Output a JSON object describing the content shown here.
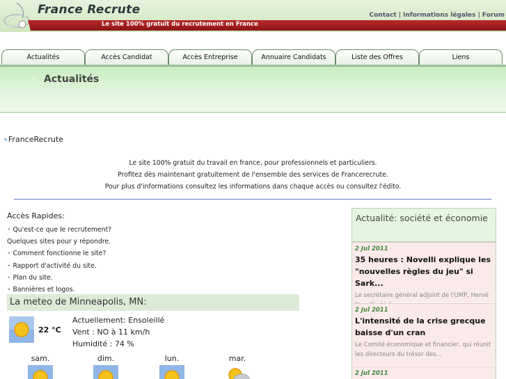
{
  "header": {
    "site_title": "France Recrute",
    "tagline": "Le site 100% gratuit du recrutement en France",
    "top_links": [
      "Contact",
      "Informations légales",
      "Forum"
    ]
  },
  "nav": {
    "tabs": [
      "Actualités",
      "Accès Candidat",
      "Accès Entreprise",
      "Annuaire Candidats",
      "Liste des Offres",
      "Liens"
    ]
  },
  "page": {
    "title": "Actualités"
  },
  "intro": {
    "heading": "FranceRecrute",
    "lines": [
      "Le site 100% gratuit du travail en france, pour professionnels et particuliers.",
      "Profitez dès maintenant gratuitement de l'ensemble des services de Francerecrute.",
      "Pour plus d'informations consultez les informations dans chaque accès ou consultez l'édito."
    ]
  },
  "quick_access": {
    "title": "Accès Rapides:",
    "link1": "Qu'est-ce que le recrutement?",
    "note": "Quelques sites pour y répondre.",
    "link2": "Comment fonctionne le site?",
    "link3": "Rapport d'activité du site.",
    "link4": "Plan du site.",
    "link5": "Bannières et logos."
  },
  "weather": {
    "title": "La meteo de Minneapolis, MN:",
    "temp": "22 °C",
    "current": "Actuellement: Ensoleillé",
    "wind": "Vent : NO à 11 km/h",
    "humidity": "Humidité : 74 %",
    "current_icon": "sun-icon",
    "forecast": [
      {
        "day": "sam.",
        "icon": "sun-icon"
      },
      {
        "day": "dim.",
        "icon": "sun-icon"
      },
      {
        "day": "lun.",
        "icon": "sun-icon"
      },
      {
        "day": "mar.",
        "icon": "partly-cloudy-icon"
      }
    ]
  },
  "news": {
    "title": "Actualité: société et économie",
    "items": [
      {
        "date": "2 Jul 2011",
        "headline": "35 heures : Novelli explique les \"nouvelles règles du jeu\" si Sark...",
        "excerpt": "Le secrétaire général adjoint de l'UMP, Hervé Novelli, déclare que si..."
      },
      {
        "date": "2 Jul 2011",
        "headline": "L'intensité de la crise grecque baisse d'un cran",
        "excerpt": "Le Comité économique et financier, qui réunit les directeurs du trésor des..."
      },
      {
        "date": "2 Jul 2011",
        "headline": "",
        "excerpt": ""
      }
    ]
  },
  "colors": {
    "accent_red": "#b82a2a",
    "header_green": "#cfe6c0",
    "band_green": "#c9ecc2",
    "news_date_green": "#3a8a3a",
    "divider_blue": "#5a7fb8"
  }
}
